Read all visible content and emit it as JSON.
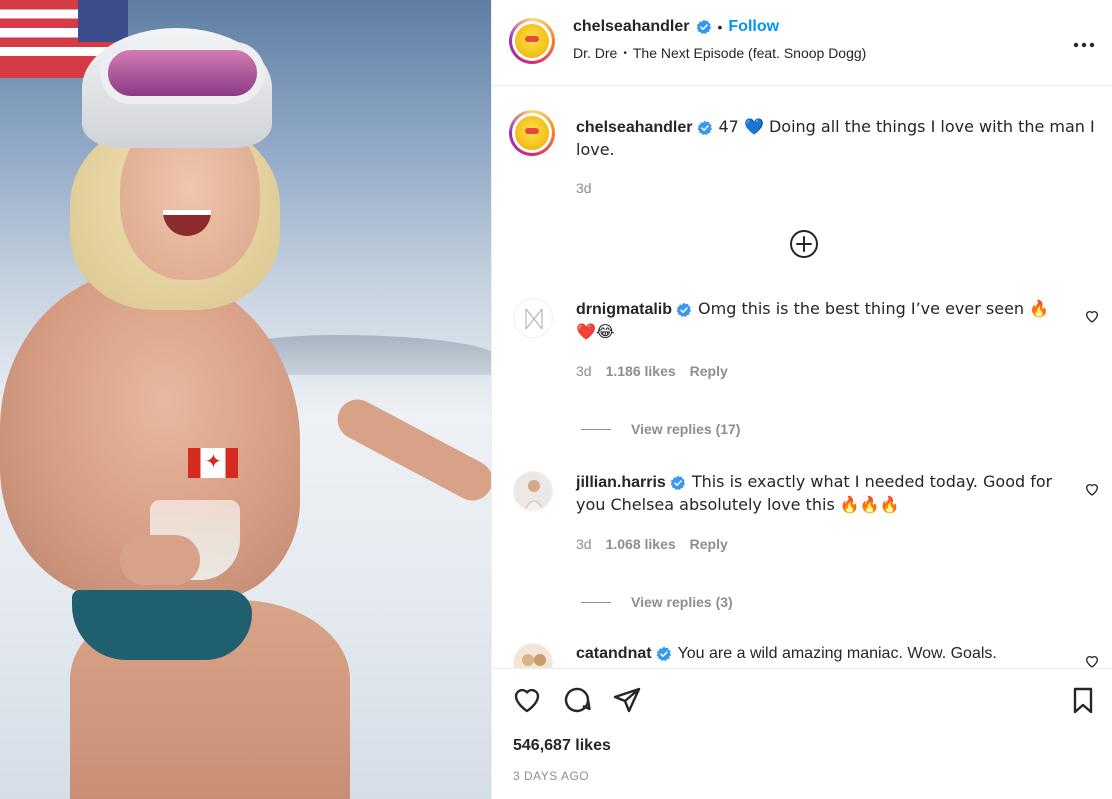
{
  "post": {
    "username": "chelseahandler",
    "follow_label": "Follow",
    "separator": "•",
    "music_artist": "Dr. Dre",
    "music_track": "The Next Episode (feat. Snoop Dogg)",
    "more_label": "•••",
    "caption_text": "47 💙 Doing all the things I love with the man I love.",
    "caption_time": "3d"
  },
  "comments": [
    {
      "username": "drnigmatalib",
      "text": "Omg this is the best thing I’ve ever seen 🔥❤️😂",
      "time": "3d",
      "likes": "1.186 likes",
      "reply_label": "Reply",
      "view_replies": "View replies (17)"
    },
    {
      "username": "jillian.harris",
      "text": "This is exactly what I needed today. Good for you Chelsea absolutely love this 🔥🔥🔥",
      "time": "3d",
      "likes": "1.068 likes",
      "reply_label": "Reply",
      "view_replies": "View replies (3)"
    },
    {
      "username": "catandnat",
      "text": "You are a wild amazing maniac. Wow. Goals."
    }
  ],
  "footer": {
    "likes": "546,687 likes",
    "ago": "3 DAYS AGO"
  },
  "icons": {
    "verified": "verified-badge-icon",
    "heart": "heart-icon",
    "comment": "comment-icon",
    "share": "share-icon",
    "save": "bookmark-icon",
    "load_more": "plus-circle-icon",
    "more": "more-options-icon"
  },
  "colors": {
    "follow": "#0095f6",
    "verified": "#3897f0",
    "muted": "#8e8e8e",
    "text": "#262626"
  }
}
